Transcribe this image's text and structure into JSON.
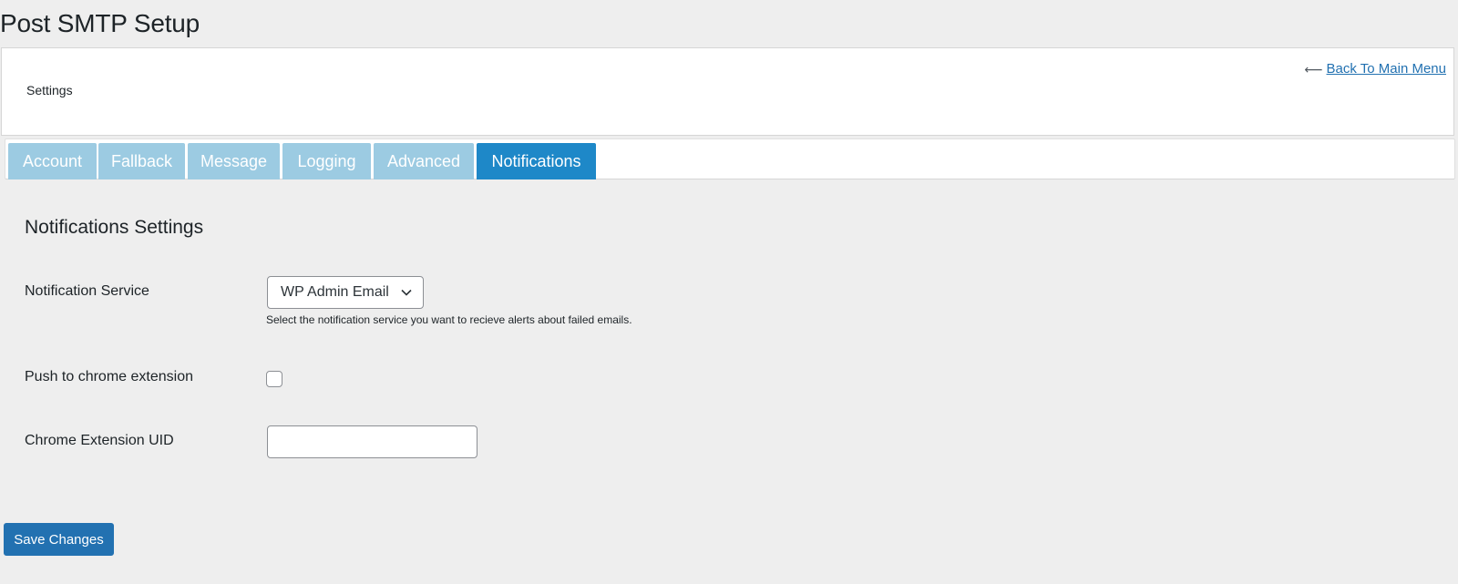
{
  "page": {
    "title": "Post SMTP Setup"
  },
  "header": {
    "settings_label": "Settings",
    "back_link": "Back To Main Menu",
    "back_arrow": "⟵"
  },
  "tabs": [
    {
      "label": "Account",
      "active": false
    },
    {
      "label": "Fallback",
      "active": false
    },
    {
      "label": "Message",
      "active": false
    },
    {
      "label": "Logging",
      "active": false
    },
    {
      "label": "Advanced",
      "active": false
    },
    {
      "label": "Notifications",
      "active": true
    }
  ],
  "section": {
    "title": "Notifications Settings"
  },
  "fields": {
    "notification_service": {
      "label": "Notification Service",
      "value": "WP Admin Email",
      "help": "Select the notification service you want to recieve alerts about failed emails."
    },
    "push_chrome": {
      "label": "Push to chrome extension",
      "checked": false
    },
    "chrome_uid": {
      "label": "Chrome Extension UID",
      "value": ""
    }
  },
  "actions": {
    "save_label": "Save Changes"
  },
  "colors": {
    "tab_inactive": "#9ccbe2",
    "tab_active": "#1e88c8",
    "primary_button": "#2271b1",
    "link": "#2271b1"
  }
}
